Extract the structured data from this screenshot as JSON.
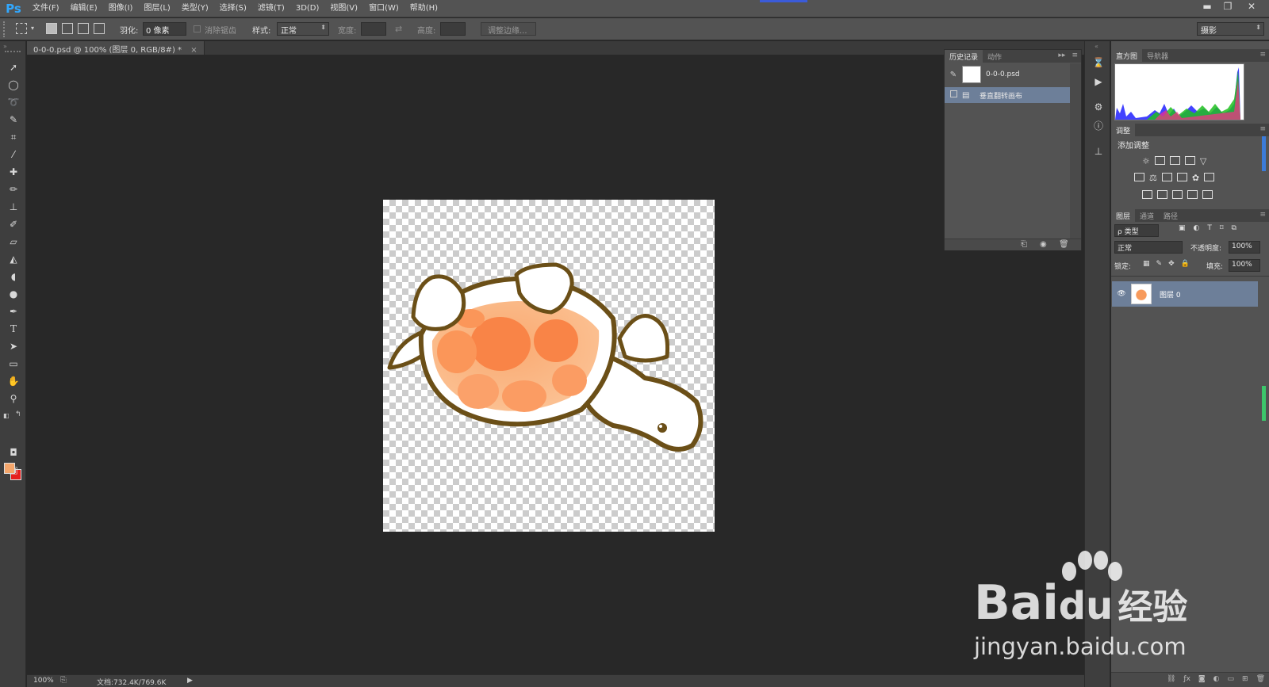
{
  "app": {
    "logo": "Ps"
  },
  "menu": [
    "文件(F)",
    "编辑(E)",
    "图像(I)",
    "图层(L)",
    "类型(Y)",
    "选择(S)",
    "滤镜(T)",
    "3D(D)",
    "视图(V)",
    "窗口(W)",
    "帮助(H)"
  ],
  "window_controls": {
    "minimize": "▬",
    "restore": "❐",
    "close": "✕"
  },
  "options": {
    "feather_label": "羽化:",
    "feather_value": "0 像素",
    "antialias_label": "消除锯齿",
    "style_label": "样式:",
    "style_value": "正常",
    "width_label": "宽度:",
    "height_label": "高度:",
    "refine_edge": "调整边缘...",
    "workspace": "摄影"
  },
  "document": {
    "tab": "0-0-0.psd @ 100% (图层 0, RGB/8#) *",
    "close": "×"
  },
  "status": {
    "zoom": "100%",
    "doc_info": "文档:732.4K/769.6K"
  },
  "history_panel": {
    "tabs": [
      "历史记录",
      "动作"
    ],
    "snapshot": "0-0-0.psd",
    "steps": [
      "垂直翻转画布"
    ]
  },
  "histogram_panel": {
    "tabs": [
      "直方图",
      "导航器"
    ]
  },
  "adjustments_panel": {
    "tab": "调整",
    "title": "添加调整"
  },
  "layers_panel": {
    "tabs": [
      "图层",
      "通道",
      "路径"
    ],
    "filter": "ρ 类型",
    "blend_mode": "正常",
    "opacity_label": "不透明度:",
    "opacity_value": "100%",
    "lock_label": "锁定:",
    "fill_label": "填充:",
    "fill_value": "100%",
    "layers": [
      {
        "name": "图层 0",
        "visible": true
      }
    ]
  },
  "watermark": {
    "brand": "Bai",
    "brand_du": "du",
    "cn": "经验",
    "url": "jingyan.baidu.com"
  },
  "colors": {
    "foreground": "#f5a66b",
    "background": "#e61e1e",
    "selection": "#6d7f99",
    "accent": "#31a8ff"
  }
}
